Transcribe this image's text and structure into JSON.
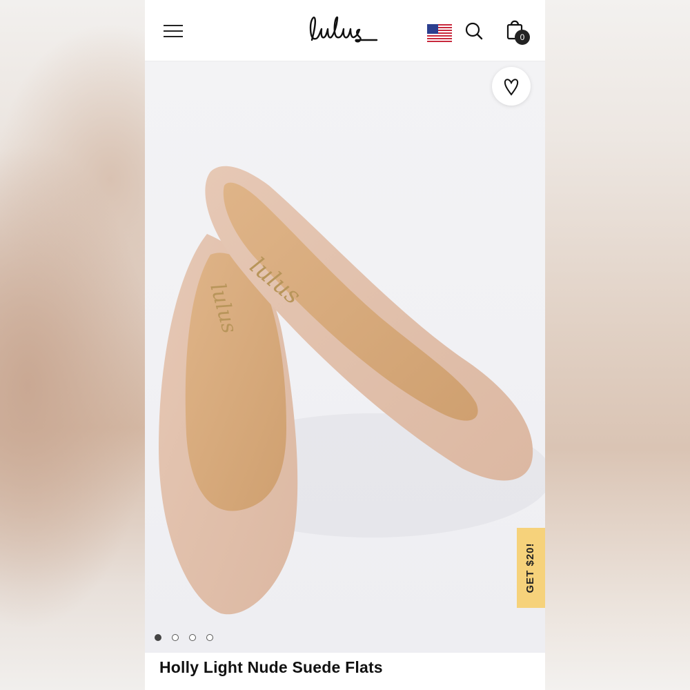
{
  "header": {
    "logo_text": "Lulus",
    "cart_count": "0"
  },
  "icons": {
    "menu": "hamburger-menu-icon",
    "flag": "us-flag-icon",
    "search": "search-icon",
    "cart": "shopping-bag-icon",
    "wishlist": "heart-icon"
  },
  "promo": {
    "label": "GET $20!"
  },
  "gallery": {
    "image_count": 4,
    "active_index": 0
  },
  "product": {
    "title": "Holly Light Nude Suede Flats"
  },
  "colors": {
    "promo_bg": "#f6d27b",
    "text": "#111111"
  }
}
